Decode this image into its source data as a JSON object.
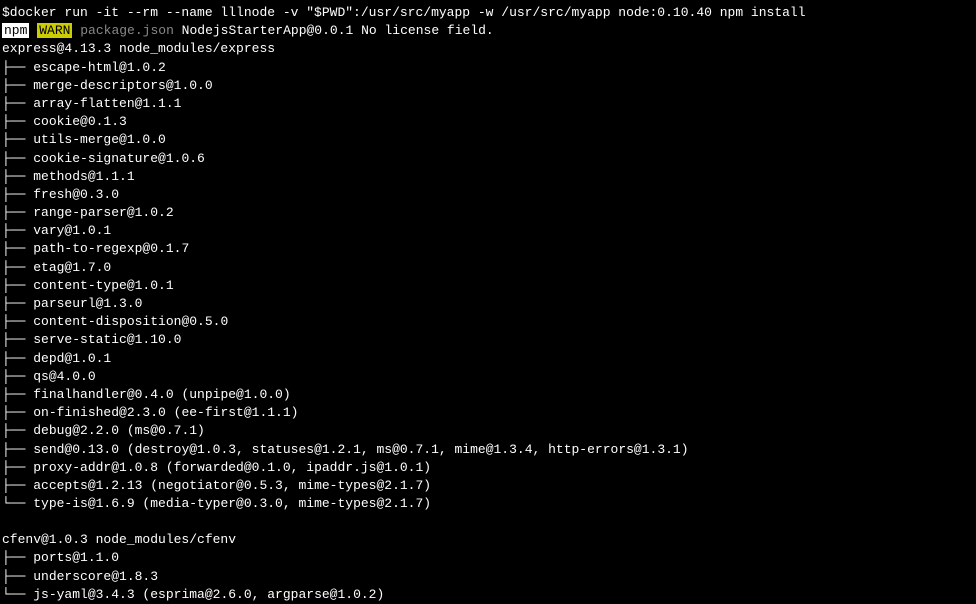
{
  "command": "$docker run -it --rm --name lllnode -v \"$PWD\":/usr/src/myapp -w /usr/src/myapp node:0.10.40 npm install",
  "npm_label": "npm",
  "warn_label": "WARN",
  "package_json": "package.json",
  "warn_msg": " NodejsStarterApp@0.0.1 No license field.",
  "express_header": "express@4.13.3 node_modules/express",
  "express_deps": [
    "escape-html@1.0.2",
    "merge-descriptors@1.0.0",
    "array-flatten@1.1.1",
    "cookie@0.1.3",
    "utils-merge@1.0.0",
    "cookie-signature@1.0.6",
    "methods@1.1.1",
    "fresh@0.3.0",
    "range-parser@1.0.2",
    "vary@1.0.1",
    "path-to-regexp@0.1.7",
    "etag@1.7.0",
    "content-type@1.0.1",
    "parseurl@1.3.0",
    "content-disposition@0.5.0",
    "serve-static@1.10.0",
    "depd@1.0.1",
    "qs@4.0.0",
    "finalhandler@0.4.0 (unpipe@1.0.0)",
    "on-finished@2.3.0 (ee-first@1.1.1)",
    "debug@2.2.0 (ms@0.7.1)",
    "send@0.13.0 (destroy@1.0.3, statuses@1.2.1, ms@0.7.1, mime@1.3.4, http-errors@1.3.1)",
    "proxy-addr@1.0.8 (forwarded@0.1.0, ipaddr.js@1.0.1)",
    "accepts@1.2.13 (negotiator@0.5.3, mime-types@2.1.7)",
    "type-is@1.6.9 (media-typer@0.3.0, mime-types@2.1.7)"
  ],
  "cfenv_header": "cfenv@1.0.3 node_modules/cfenv",
  "cfenv_deps": [
    "ports@1.1.0",
    "underscore@1.8.3",
    "js-yaml@3.4.3 (esprima@2.6.0, argparse@1.0.2)"
  ],
  "branch_mid": "├── ",
  "branch_last": "└── "
}
